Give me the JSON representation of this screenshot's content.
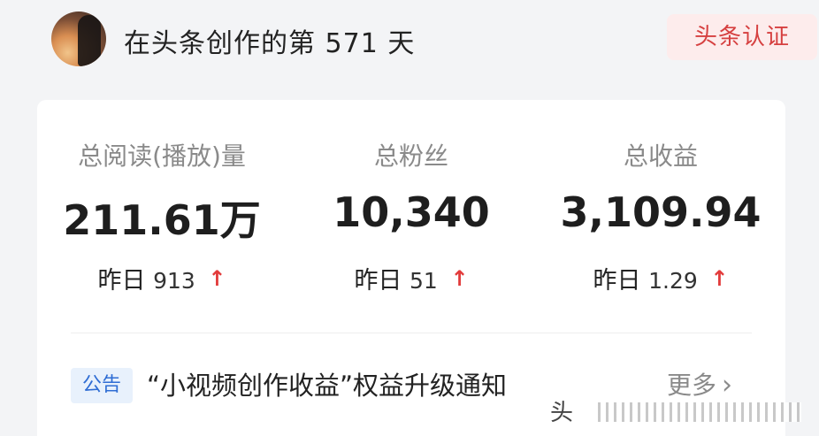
{
  "header": {
    "title": "在头条创作的第 571 天",
    "badge": "头条认证"
  },
  "stats": [
    {
      "label": "总阅读(播放)量",
      "value": "211.61万",
      "yday_label": "昨日",
      "yday_value": "913"
    },
    {
      "label": "总粉丝",
      "value": "10,340",
      "yday_label": "昨日",
      "yday_value": "51"
    },
    {
      "label": "总收益",
      "value": "3,109.94",
      "yday_label": "昨日",
      "yday_value": "1.29"
    }
  ],
  "notice": {
    "tag": "公告",
    "text": "“小视频创作收益”权益升级通知",
    "more": "更多"
  },
  "icons": {
    "up_arrow": "arrow-up-icon",
    "chevron": "chevron-right-icon"
  },
  "colors": {
    "badge_text": "#d64040",
    "badge_bg": "#fdecec",
    "up_arrow": "#e23b3b",
    "notice_tag_text": "#2f6dd4",
    "notice_tag_bg": "#e8f1fc"
  },
  "watermark": "头"
}
